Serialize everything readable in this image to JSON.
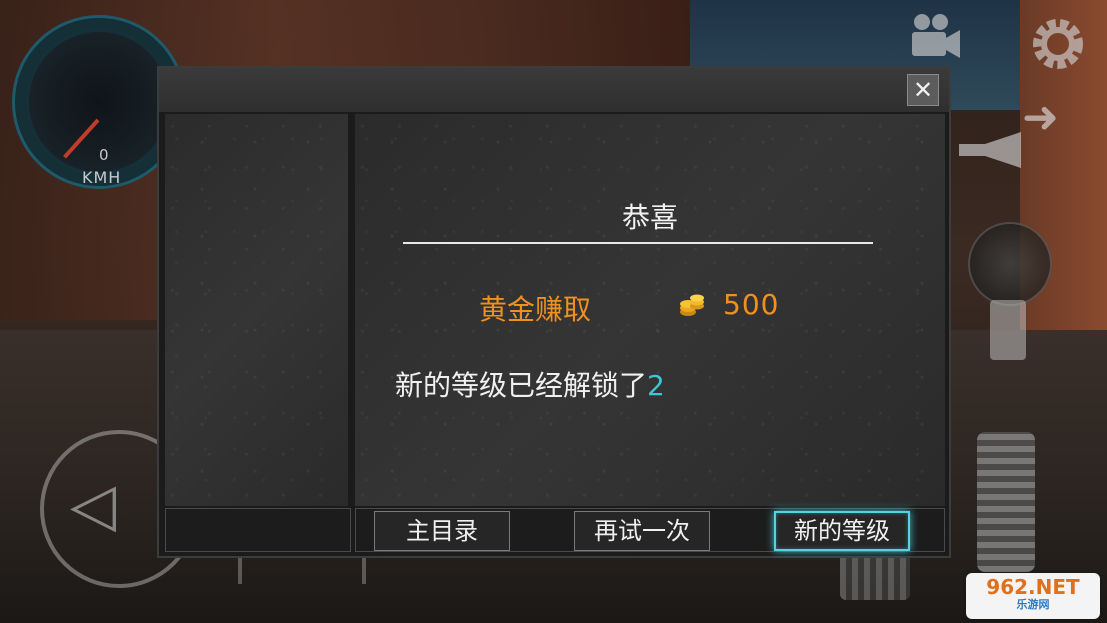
{
  "hud": {
    "speed_value": "0",
    "speed_unit": "KMH"
  },
  "dialog": {
    "close_label": "✕",
    "title": "恭喜",
    "gold_label": "黄金赚取",
    "gold_amount": "500",
    "unlock_text": "新的等级已经解锁了",
    "unlock_level": "2"
  },
  "buttons": {
    "main_menu": "主目录",
    "retry": "再试一次",
    "next_level": "新的等级"
  },
  "watermark": {
    "brand": "962.NET",
    "sub": "乐游网"
  },
  "colors": {
    "gold_text": "#f0901e",
    "level_number": "#3ec5d8",
    "highlight_border": "#55d3e0"
  }
}
